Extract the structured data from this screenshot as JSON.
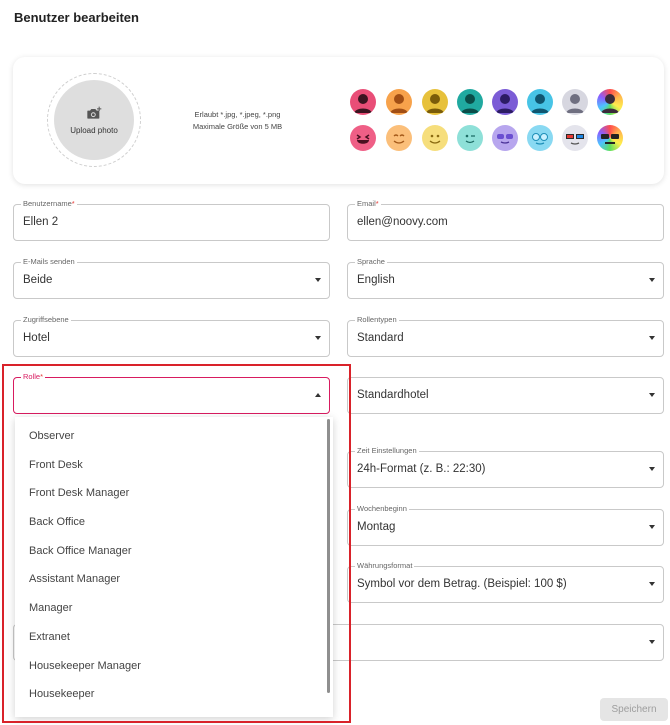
{
  "page": {
    "title": "Benutzer bearbeiten"
  },
  "upload": {
    "label": "Upload photo",
    "allowed": "Erlaubt *.jpg, *.jpeg, *.png",
    "max_size": "Maximale Größe von 5 MB"
  },
  "avatars": {
    "row1": [
      {
        "name": "avatar-red",
        "color": "#e94e77"
      },
      {
        "name": "avatar-orange",
        "color": "#f7a24b"
      },
      {
        "name": "avatar-yellow",
        "color": "#e7c13b"
      },
      {
        "name": "avatar-teal",
        "color": "#20a9a0"
      },
      {
        "name": "avatar-purple",
        "color": "#7b5cd6"
      },
      {
        "name": "avatar-cyan",
        "color": "#47c4e6"
      },
      {
        "name": "avatar-grey",
        "color": "#bdbdc9"
      },
      {
        "name": "avatar-rainbow",
        "color": "#ff6f61"
      }
    ],
    "row2": [
      {
        "name": "emoji-laughing",
        "color": "#ef5f86"
      },
      {
        "name": "emoji-smiling",
        "color": "#fbbf7a"
      },
      {
        "name": "emoji-happy",
        "color": "#f6de7c"
      },
      {
        "name": "emoji-wink",
        "color": "#8ee0d8"
      },
      {
        "name": "emoji-sunglasses-purple",
        "color": "#b7a6ee"
      },
      {
        "name": "emoji-sunglasses-cyan",
        "color": "#89d9f2"
      },
      {
        "name": "emoji-3d-glasses",
        "color": "#e4e4ec"
      },
      {
        "name": "emoji-rainbow-glasses",
        "color": "#ff8a5b"
      }
    ]
  },
  "form": {
    "benutzername": {
      "label": "Benutzername",
      "req": "*",
      "value": "Ellen 2"
    },
    "email": {
      "label": "Email",
      "req": "*",
      "value": "ellen@noovy.com"
    },
    "emails_senden": {
      "label": "E-Mails senden",
      "value": "Beide"
    },
    "sprache": {
      "label": "Sprache",
      "value": "English"
    },
    "zugriffsebene": {
      "label": "Zugriffsebene",
      "value": "Hotel"
    },
    "rollentypen": {
      "label": "Rollentypen",
      "value": "Standard"
    },
    "rolle": {
      "label": "Rolle",
      "req": "*",
      "value": ""
    },
    "hotel": {
      "value": "Standardhotel"
    },
    "zeit": {
      "label": "Zeit Einstellungen",
      "value": "24h-Format (z. B.: 22:30)"
    },
    "wochenbeginn": {
      "label": "Wochenbeginn",
      "value": "Montag"
    },
    "waehrung": {
      "label": "Währungsformat",
      "value": "Symbol vor dem Betrag. (Beispiel: 100 $)"
    },
    "extra": {
      "value": ""
    }
  },
  "rolle_options": [
    "Observer",
    "Front Desk",
    "Front Desk Manager",
    "Back Office",
    "Back Office Manager",
    "Assistant Manager",
    "Manager",
    "Extranet",
    "Housekeeper Manager",
    "Housekeeper"
  ],
  "actions": {
    "save": "Speichern"
  },
  "colors": {
    "accent": "#d81b60",
    "highlight": "#d9222a"
  }
}
